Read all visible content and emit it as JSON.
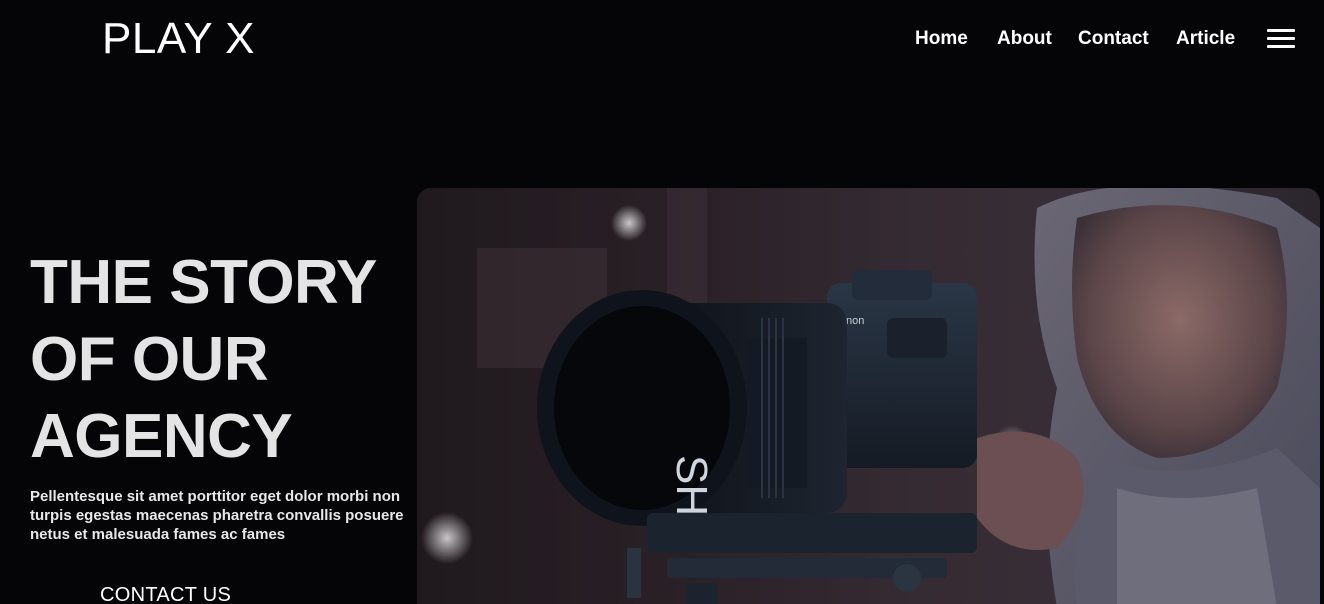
{
  "brand": {
    "logo_text": "PLAY X"
  },
  "nav": {
    "items": [
      {
        "label": "Home"
      },
      {
        "label": "About"
      },
      {
        "label": "Contact"
      },
      {
        "label": "Article"
      }
    ],
    "menu_icon": "hamburger-menu-icon"
  },
  "hero": {
    "title_lines": [
      "THE STORY",
      "OF OUR",
      "AGENCY"
    ],
    "description": "Pellentesque sit amet porttitor eget dolor morbi non turpis egestas maecenas pharetra convallis posuere netus et malesuada fames ac fames",
    "cta_label": "CONTACT US",
    "image_subject": "videographer-with-camera-photo",
    "camera_brand_text": "Canon",
    "lens_marking": "SH"
  },
  "colors": {
    "background": "#050507",
    "text_primary": "#ffffff",
    "hero_title": "#e4e4e4"
  }
}
